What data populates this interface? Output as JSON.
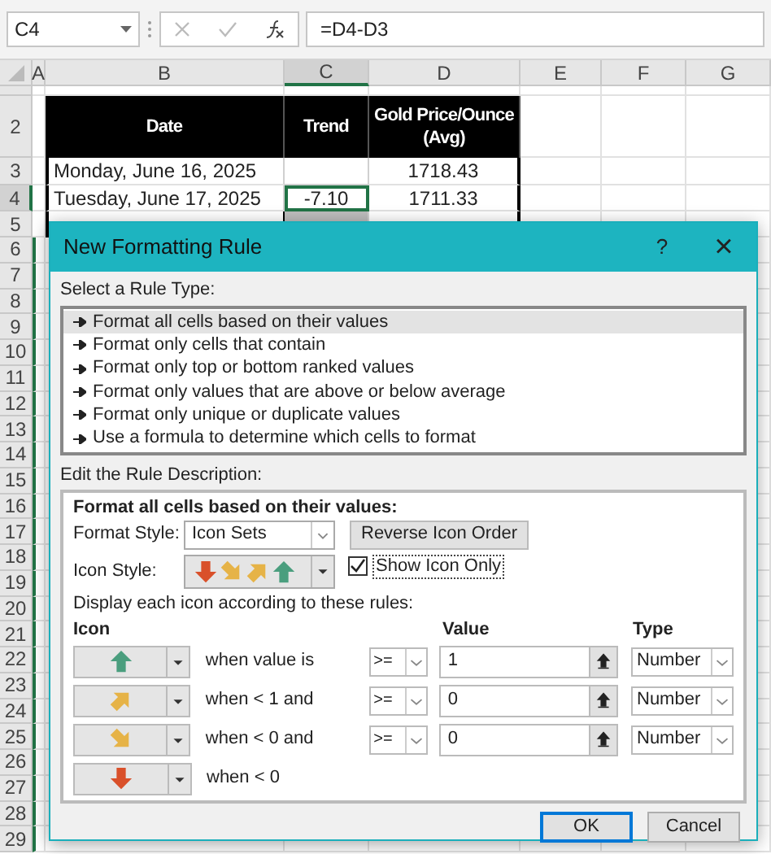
{
  "formula_bar": {
    "name_box": "C4",
    "formula": "=D4-D3"
  },
  "columns": [
    {
      "label": "A",
      "selected": false
    },
    {
      "label": "B",
      "selected": false
    },
    {
      "label": "C",
      "selected": true
    },
    {
      "label": "D",
      "selected": false
    },
    {
      "label": "E",
      "selected": false
    },
    {
      "label": "F",
      "selected": false
    },
    {
      "label": "G",
      "selected": false
    }
  ],
  "row_numbers": [
    {
      "label": "2",
      "selected": false
    },
    {
      "label": "3",
      "selected": false
    },
    {
      "label": "4",
      "selected": true
    },
    {
      "label": "5",
      "selected": false
    },
    {
      "label": "6",
      "selected": false
    },
    {
      "label": "7",
      "selected": false
    },
    {
      "label": "8",
      "selected": false
    },
    {
      "label": "9",
      "selected": false
    },
    {
      "label": "10",
      "selected": false
    },
    {
      "label": "11",
      "selected": false
    },
    {
      "label": "12",
      "selected": false
    },
    {
      "label": "13",
      "selected": false
    },
    {
      "label": "14",
      "selected": false
    },
    {
      "label": "15",
      "selected": false
    },
    {
      "label": "16",
      "selected": false
    },
    {
      "label": "17",
      "selected": false
    },
    {
      "label": "18",
      "selected": false
    },
    {
      "label": "19",
      "selected": false
    },
    {
      "label": "20",
      "selected": false
    },
    {
      "label": "21",
      "selected": false
    },
    {
      "label": "22",
      "selected": false
    },
    {
      "label": "23",
      "selected": false
    },
    {
      "label": "24",
      "selected": false
    },
    {
      "label": "25",
      "selected": false
    },
    {
      "label": "26",
      "selected": false
    },
    {
      "label": "27",
      "selected": false
    },
    {
      "label": "28",
      "selected": false
    },
    {
      "label": "29",
      "selected": false
    }
  ],
  "table": {
    "headers": [
      "Date",
      "Trend",
      "Gold Price/Ounce (Avg)"
    ],
    "rows": [
      {
        "date": "Monday, June 16, 2025",
        "trend": "",
        "price": "1718.43",
        "selected": false
      },
      {
        "date": "Tuesday, June 17, 2025",
        "trend": "-7.10",
        "price": "1711.33",
        "selected": true
      }
    ]
  },
  "dialog": {
    "title": "New Formatting Rule",
    "help": "?",
    "close": "×",
    "rule_type_label": "Select a Rule Type:",
    "rule_types": [
      {
        "label": "Format all cells based on their values",
        "selected": true
      },
      {
        "label": "Format only cells that contain",
        "selected": false
      },
      {
        "label": "Format only top or bottom ranked values",
        "selected": false
      },
      {
        "label": "Format only values that are above or below average",
        "selected": false
      },
      {
        "label": "Format only unique or duplicate values",
        "selected": false
      },
      {
        "label": "Use a formula to determine which cells to format",
        "selected": false
      }
    ],
    "description_label": "Edit the Rule Description:",
    "heading": "Format all cells based on their values:",
    "format_style_label": "Format Style:",
    "format_style": "Icon Sets",
    "reverse_button": "Reverse Icon Order",
    "icon_style_label": "Icon Style:",
    "icon_style": [
      {
        "kind": "down"
      },
      {
        "kind": "diag_down"
      },
      {
        "kind": "diag_up"
      },
      {
        "kind": "up"
      }
    ],
    "show_icon_only": {
      "label": "Show Icon Only",
      "checked": true
    },
    "display_label": "Display each icon according to these rules:",
    "col_icon": "Icon",
    "col_value": "Value",
    "col_type": "Type",
    "rules": [
      {
        "kind": "up",
        "condition": "when value is",
        "operator": ">=",
        "value": "1",
        "type": "Number"
      },
      {
        "kind": "diag_up",
        "condition": "when < 1 and",
        "operator": ">=",
        "value": "0",
        "type": "Number"
      },
      {
        "kind": "diag_down",
        "condition": "when < 0 and",
        "operator": ">=",
        "value": "0",
        "type": "Number"
      },
      {
        "kind": "down",
        "condition": "when < 0"
      }
    ],
    "buttons": [
      {
        "label": "OK",
        "default": true
      },
      {
        "label": "Cancel",
        "default": false
      }
    ]
  }
}
